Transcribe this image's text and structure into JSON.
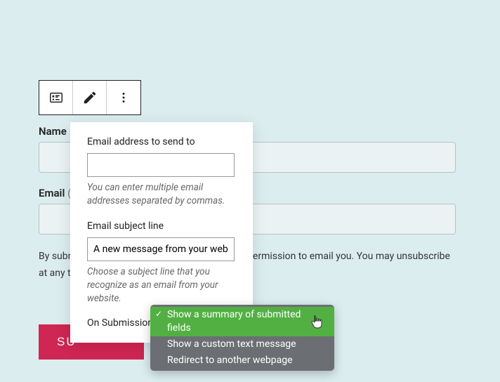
{
  "toolbar": {
    "icon1": "form-block-icon",
    "icon2": "pencil-icon",
    "icon3": "more-icon"
  },
  "form": {
    "name_label": "Name",
    "email_label": "Email",
    "email_required_marker": "(",
    "consent_text": "By submitting your information, you're giving us permission to email you. You may unsubscribe at any time.",
    "submit_label": "SU"
  },
  "popover": {
    "email_to_label": "Email address to send to",
    "email_to_value": "",
    "email_to_help": "You can enter multiple email addresses separated by commas.",
    "subject_label": "Email subject line",
    "subject_value": "A new message from your webs",
    "subject_help": "Choose a subject line that you recognize as an email from your website.",
    "on_submission_label": "On Submission"
  },
  "dropdown": {
    "items": [
      {
        "label": "Show a summary of submitted fields",
        "selected": true
      },
      {
        "label": "Show a custom text message",
        "selected": false
      },
      {
        "label": "Redirect to another webpage",
        "selected": false
      }
    ]
  }
}
